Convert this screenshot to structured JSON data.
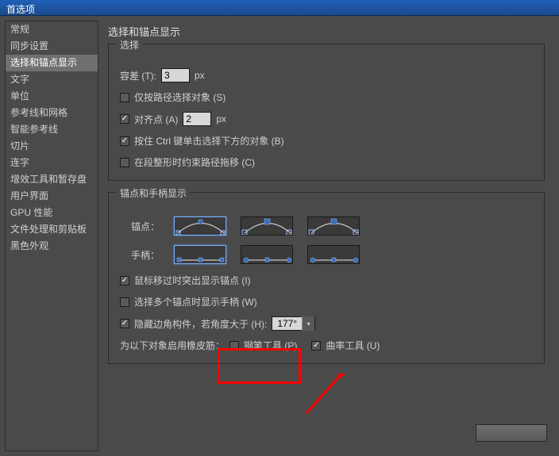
{
  "titlebar": "首选项",
  "sidebar": {
    "items": [
      {
        "label": "常规"
      },
      {
        "label": "同步设置"
      },
      {
        "label": "选择和锚点显示",
        "selected": true
      },
      {
        "label": "文字"
      },
      {
        "label": "单位"
      },
      {
        "label": "参考线和网格"
      },
      {
        "label": "智能参考线"
      },
      {
        "label": "切片"
      },
      {
        "label": "连字"
      },
      {
        "label": "增效工具和暂存盘"
      },
      {
        "label": "用户界面"
      },
      {
        "label": "GPU 性能"
      },
      {
        "label": "文件处理和剪贴板"
      },
      {
        "label": "黑色外观"
      }
    ]
  },
  "content": {
    "page_title": "选择和锚点显示",
    "group1": {
      "title": "选择",
      "tolerance_label": "容差 (T):",
      "tolerance_value": "3",
      "tolerance_unit": "px",
      "path_select_label": "仅按路径选择对象 (S)",
      "path_select_checked": false,
      "snap_label": "对齐点 (A)",
      "snap_checked": true,
      "snap_value": "2",
      "snap_unit": "px",
      "ctrl_click_label": "按住 Ctrl 键单击选择下方的对象 (B)",
      "ctrl_click_checked": true,
      "reshape_label": "在段整形时约束路径拖移 (C)",
      "reshape_checked": false
    },
    "group2": {
      "title": "锚点和手柄显示",
      "anchor_label": "锚点：",
      "handle_label": "手柄：",
      "highlight_hover_label": "鼠标移过时突出显示锚点 (I)",
      "highlight_hover_checked": true,
      "multi_anchor_label": "选择多个锚点时显示手柄 (W)",
      "multi_anchor_checked": false,
      "hide_corner_label": "隐藏边角构件，若角度大于 (H):",
      "hide_corner_checked": true,
      "hide_corner_value": "177°",
      "rubber_prefix": "为以下对象启用橡皮筋：",
      "pen_tool_label": "钢笔工具 (P)",
      "pen_tool_checked": false,
      "curve_tool_label": "曲率工具 (U)",
      "curve_tool_checked": true
    }
  }
}
